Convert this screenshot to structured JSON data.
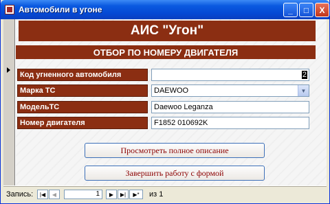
{
  "window": {
    "title": "Автомобили в угоне",
    "min_label": "_",
    "max_label": "□",
    "close_label": "X"
  },
  "form": {
    "header": "АИС \"Угон\"",
    "subheader": "ОТБОР ПО НОМЕРУ ДВИГАТЕЛЯ",
    "fields": [
      {
        "label": "Код угненного автомобиля",
        "value": "2"
      },
      {
        "label": "Марка ТС",
        "value": "DAEWOO"
      },
      {
        "label": "МодельТС",
        "value": "Daewoo Leganza"
      },
      {
        "label": "Номер двигателя",
        "value": "F1852 010692K"
      }
    ],
    "buttons": {
      "view": "Просмотреть полное описание",
      "close": "Завершить работу с формой"
    }
  },
  "navigation": {
    "label": "Запись:",
    "current": "1",
    "of_text": "из  1",
    "first": "|◀",
    "prev": "◀",
    "next": "▶",
    "last": "▶|",
    "new": "▶*"
  },
  "colors": {
    "header_bg": "#8b2e12",
    "button_text": "#8b0000",
    "titlebar": "#0549d4"
  }
}
